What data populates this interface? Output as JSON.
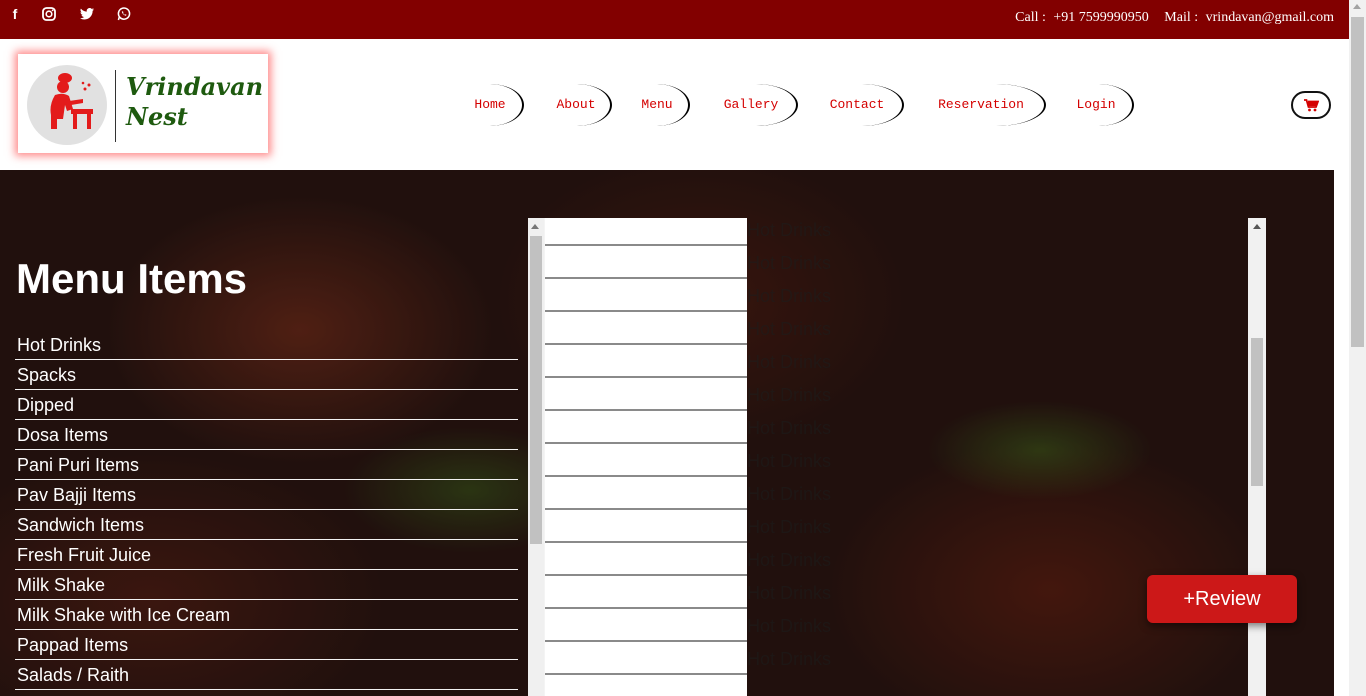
{
  "topbar": {
    "social": [
      "facebook-icon",
      "instagram-icon",
      "twitter-icon",
      "whatsapp-icon"
    ],
    "call_label": "Call :",
    "phone": "+91 7599990950",
    "mail_label": "Mail :",
    "email": "vrindavan@gmail.com"
  },
  "logo": {
    "line1": "Vrindavan",
    "line2": "Nest"
  },
  "nav": [
    "Home",
    "About",
    "Menu",
    "Gallery",
    "Contact",
    "Reservation",
    "Login"
  ],
  "cart_icon": "cart-icon",
  "hero": {
    "title": "Menu Items",
    "categories": [
      "Hot Drinks",
      "Spacks",
      "Dipped",
      "Dosa Items",
      "Pani Puri Items",
      "Pav Bajji Items",
      "Sandwich Items",
      "Fresh Fruit Juice",
      "Milk Shake",
      "Milk Shake with Ice Cream",
      "Pappad Items",
      "Salads / Raith"
    ],
    "ghost_item": "Hot Drinks"
  },
  "review_button": "+Review",
  "colors": {
    "topbar": "#820000",
    "nav_text": "#d40000",
    "logo_text": "#1e5a0f",
    "review": "#cc1818"
  }
}
